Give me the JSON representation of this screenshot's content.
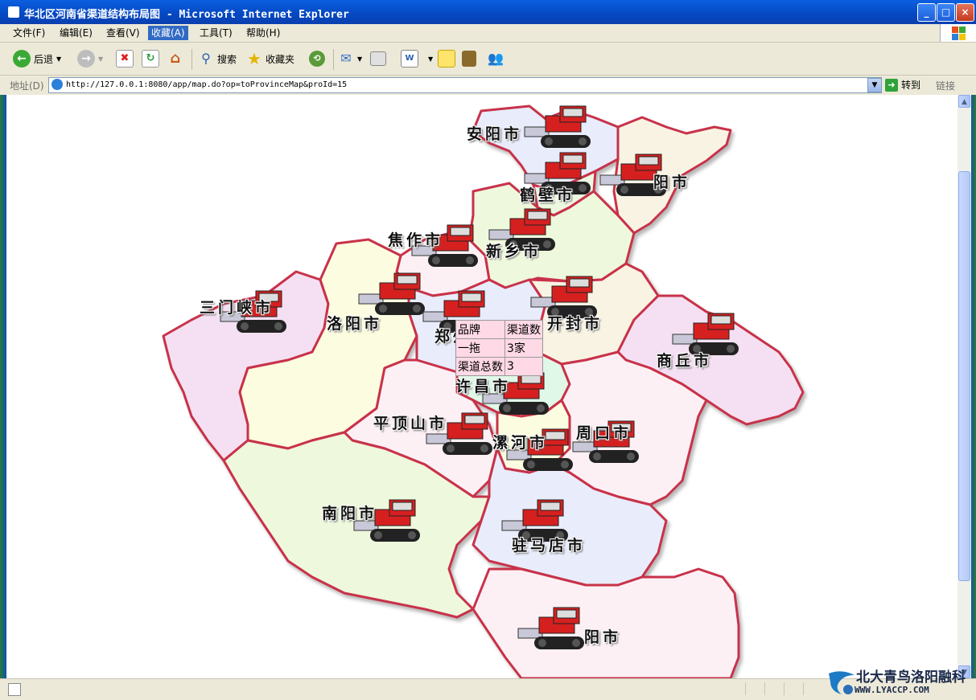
{
  "window": {
    "title": "华北区河南省渠道结构布局图 - Microsoft Internet Explorer",
    "minimize": "_",
    "maximize": "□",
    "close": "×"
  },
  "menu": [
    "文件(F)",
    "编辑(E)",
    "查看(V)",
    "收藏(A)",
    "工具(T)",
    "帮助(H)"
  ],
  "menu_active_index": 3,
  "toolbar": {
    "back": "后退",
    "search": "搜索",
    "favorites": "收藏夹"
  },
  "address": {
    "label": "地址(D)",
    "url": "http://127.0.0.1:8080/app/map.do?op=toProvinceMap&proId=15",
    "go": "转到",
    "links": "链接"
  },
  "map": {
    "cities": [
      {
        "key": "anyang",
        "label": "安阳市"
      },
      {
        "key": "puyang",
        "label": "阳市"
      },
      {
        "key": "hebi",
        "label": "鹤壁市"
      },
      {
        "key": "jiaozuo",
        "label": "焦作市"
      },
      {
        "key": "xinxiang",
        "label": "新乡市"
      },
      {
        "key": "sanmenxia",
        "label": "三门峡市"
      },
      {
        "key": "luoyang",
        "label": "洛阳市"
      },
      {
        "key": "zhengzhou",
        "label": "郑州市"
      },
      {
        "key": "kaifeng",
        "label": "开封市"
      },
      {
        "key": "shangqiu",
        "label": "商丘市"
      },
      {
        "key": "xuchang",
        "label": "许昌市"
      },
      {
        "key": "pingdingshan",
        "label": "平顶山市"
      },
      {
        "key": "luohe",
        "label": "漯河市"
      },
      {
        "key": "zhoukou",
        "label": "周口市"
      },
      {
        "key": "nanyang",
        "label": "南阳市"
      },
      {
        "key": "zhumadian",
        "label": "驻马店市"
      },
      {
        "key": "xinyang",
        "label": "阳市"
      }
    ],
    "tooltip": {
      "header": [
        "品牌",
        "渠道数"
      ],
      "rows": [
        [
          "一拖",
          "3家"
        ]
      ],
      "total_label": "渠道总数",
      "total_value": "3"
    }
  },
  "watermark": {
    "line1": "北大青鸟洛阳融科",
    "line2": "WWW.LYACCP.COM"
  },
  "colors": {
    "border": "#c8304a",
    "accent": "#316ac5"
  }
}
